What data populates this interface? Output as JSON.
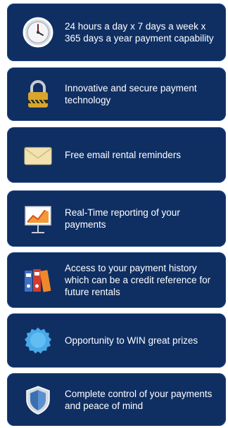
{
  "colors": {
    "card_bg": "#0f2f63",
    "card_border": "#1b427f",
    "text": "#ffffff"
  },
  "features": [
    {
      "icon": "clock-icon",
      "text": "24 hours a day x 7 days a week x 365 days a year payment capability"
    },
    {
      "icon": "padlock-icon",
      "text": "Innovative and secure payment technology"
    },
    {
      "icon": "envelope-icon",
      "text": "Free email rental reminders"
    },
    {
      "icon": "chart-board-icon",
      "text": "Real-Time reporting of your payments"
    },
    {
      "icon": "binders-icon",
      "text": "Access to your payment history which can be a credit reference for future rentals"
    },
    {
      "icon": "rosette-badge-icon",
      "text": "Opportunity to WIN great prizes"
    },
    {
      "icon": "shield-icon",
      "text": "Complete control of your payments and peace of mind"
    }
  ]
}
